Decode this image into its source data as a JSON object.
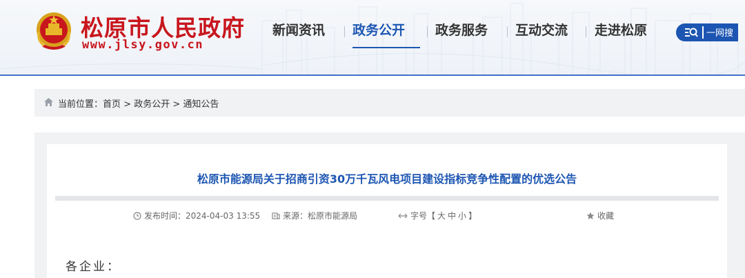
{
  "header": {
    "site_name": "松原市人民政府",
    "site_url": "www.jlsy.gov.cn",
    "nav": [
      {
        "label": "新闻资讯",
        "active": false
      },
      {
        "label": "政务公开",
        "active": true
      },
      {
        "label": "政务服务",
        "active": false
      },
      {
        "label": "互动交流",
        "active": false
      },
      {
        "label": "走进松原",
        "active": false
      }
    ],
    "search_label": "一网搜"
  },
  "breadcrumb": {
    "prefix": "当前位置：",
    "items": [
      "首页",
      "政务公开",
      "通知公告"
    ],
    "separator": " > "
  },
  "article": {
    "title": "松原市能源局关于招商引资30万千瓦风电项目建设指标竞争性配置的优选公告",
    "published_label": "发布时间：",
    "published_value": "2024-04-03 13:55",
    "source_label": "来源：",
    "source_value": "松原市能源局",
    "font_size_label": "字号【",
    "font_size_options": [
      "大",
      "中",
      "小"
    ],
    "font_size_close": "】",
    "favorite_label": "收藏",
    "greeting": "各企业："
  },
  "colors": {
    "brand_red": "#c8161d",
    "accent_blue": "#1d56b2",
    "panel_gray": "#f1f2f4"
  },
  "icons": {
    "emblem": "national-emblem-icon",
    "search": "search-icon",
    "home": "home-icon",
    "clock": "clock-icon",
    "source": "source-icon",
    "font_size": "double-arrow-icon",
    "favorite": "star-icon"
  }
}
